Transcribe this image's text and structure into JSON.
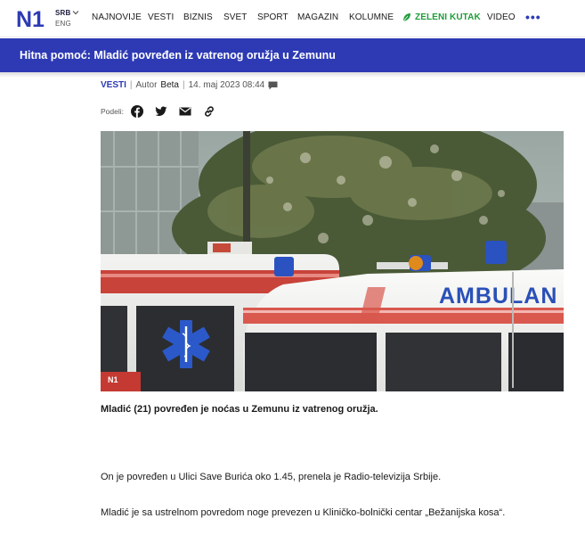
{
  "brand": {
    "logo_text": "N1",
    "lang_primary": "SRB",
    "lang_secondary": "ENG",
    "accent": "#2d3ab4",
    "green": "#1f9d3a"
  },
  "nav": {
    "items": [
      {
        "label": "NAJNOVIJE"
      },
      {
        "label": "VESTI"
      },
      {
        "label": "BIZNIS"
      },
      {
        "label": "SVET"
      },
      {
        "label": "SPORT"
      },
      {
        "label": "MAGAZIN"
      },
      {
        "label": "KOLUMNE"
      },
      {
        "label": "ZELENI KUTAK"
      },
      {
        "label": "VIDEO"
      }
    ],
    "more": "•••"
  },
  "article": {
    "title": "Hitna pomoć: Mladić povređen iz vatrenog oružja u Zemunu",
    "category": "VESTI",
    "author_label": "Autor",
    "author": "Beta",
    "date": "14. maj 2023 08:44",
    "share_label": "Podeli:",
    "share_icons": [
      "facebook-icon",
      "twitter-icon",
      "email-icon",
      "link-icon"
    ],
    "photo": {
      "ambulance_text": "AMBULAN",
      "watermark": "N1"
    },
    "caption": "Mladić (21) povređen je noćas u Zemunu iz vatrenog oružja.",
    "paragraphs": [
      "On je povređen u Ulici Save Burića oko 1.45, prenela je Radio-televizija Srbije.",
      "Mladić je sa ustrelnom povredom noge prevezen u Kliničko-bolnički centar „Bežanijska kosa“."
    ]
  }
}
